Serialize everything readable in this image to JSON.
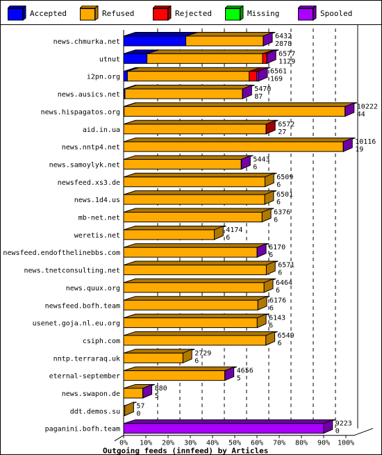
{
  "chart_data": {
    "type": "bar",
    "orientation": "horizontal",
    "stacked": true,
    "style": "3d",
    "title": "Outgoing feeds (innfeed) by Articles",
    "xlabel": "Outgoing feeds (innfeed) by Articles",
    "ylabel": "",
    "xlim": [
      0,
      100
    ],
    "x_ticks": [
      "0%",
      "10%",
      "20%",
      "30%",
      "40%",
      "50%",
      "60%",
      "70%",
      "80%",
      "90%",
      "100%"
    ],
    "grid": "vertical-dashed",
    "legend": {
      "placement": "top",
      "entries": [
        {
          "name": "Accepted",
          "color": "#0000ff",
          "side": "#0000a0"
        },
        {
          "name": "Refused",
          "color": "#ffaa00",
          "side": "#b07800"
        },
        {
          "name": "Rejected",
          "color": "#ff0000",
          "side": "#a00000"
        },
        {
          "name": "Missing",
          "color": "#00ff00",
          "side": "#00a000"
        },
        {
          "name": "Spooled",
          "color": "#aa00ff",
          "side": "#7000a8"
        }
      ]
    },
    "categories": [
      "news.chmurka.net",
      "utnut",
      "i2pn.org",
      "news.ausics.net",
      "news.hispagatos.org",
      "aid.in.ua",
      "news.nntp4.net",
      "news.samoylyk.net",
      "newsfeed.xs3.de",
      "news.1d4.us",
      "mb-net.net",
      "weretis.net",
      "newsfeed.endofthelinebbs.com",
      "news.tnetconsulting.net",
      "news.quux.org",
      "newsfeed.bofh.team",
      "usenet.goja.nl.eu.org",
      "csiph.com",
      "nntp.terraraq.uk",
      "eternal-september",
      "news.swapon.de",
      "ddt.demos.su",
      "paganini.bofh.team"
    ],
    "series_percent": [
      {
        "name": "Accepted",
        "values": [
          28.0,
          10.5,
          1.7,
          0.6,
          0.2,
          0.0,
          0.0,
          0.0,
          0,
          0,
          0,
          0,
          0,
          0,
          0,
          0,
          0,
          0,
          0,
          0,
          0,
          0,
          0
        ]
      },
      {
        "name": "Refused",
        "values": [
          34.8,
          52.0,
          54.8,
          52.9,
          99.4,
          64.1,
          98.8,
          52.9,
          63.6,
          63.5,
          62.3,
          40.8,
          60.0,
          64.2,
          63.2,
          60.4,
          60.1,
          64.0,
          26.7,
          45.5,
          8.6,
          0.5,
          0.0
        ]
      },
      {
        "name": "Rejected",
        "values": [
          0.0,
          1.9,
          3.4,
          0.0,
          0.0,
          0.1,
          0.0,
          0.0,
          0,
          0,
          0,
          0,
          0,
          0,
          0,
          0,
          0,
          0,
          0,
          0,
          0,
          0,
          0
        ]
      },
      {
        "name": "Missing",
        "values": [
          0,
          0,
          0,
          0,
          0,
          0,
          0,
          0,
          0,
          0,
          0,
          0,
          0,
          0,
          0,
          0,
          0,
          0,
          0,
          0,
          0,
          0,
          0
        ]
      },
      {
        "name": "Spooled",
        "values": [
          0.1,
          0.1,
          0.8,
          0.1,
          0.1,
          0.0,
          0.1,
          0.1,
          0.0,
          0.0,
          0.0,
          0.0,
          0.1,
          0.0,
          0.0,
          0.0,
          0.0,
          0.0,
          0.0,
          0.1,
          0.1,
          0.0,
          90.0
        ]
      }
    ],
    "end_cap_series": [
      "Spooled",
      "Spooled",
      "Spooled",
      "Spooled",
      "Spooled",
      "Rejected",
      "Spooled",
      "Spooled",
      "Refused",
      "Refused",
      "Refused",
      "Refused",
      "Spooled",
      "Refused",
      "Refused",
      "Refused",
      "Refused",
      "Refused",
      "Refused",
      "Spooled",
      "Spooled",
      "Refused",
      "Spooled"
    ],
    "labels_total": [
      "6432",
      "6577",
      "6561",
      "5470",
      "10222",
      "6572",
      "10116",
      "5443",
      "6509",
      "6501",
      "6376",
      "4174",
      "6170",
      "6571",
      "6464",
      "6176",
      "6143",
      "6549",
      "2729",
      "4656",
      "880",
      "57",
      "9223"
    ],
    "labels_secondary": [
      "2878",
      "1129",
      "169",
      "87",
      "44",
      "27",
      "19",
      "6",
      "6",
      "6",
      "6",
      "6",
      "6",
      "6",
      "6",
      "6",
      "6",
      "6",
      "6",
      "5",
      "5",
      "0",
      "0"
    ]
  }
}
